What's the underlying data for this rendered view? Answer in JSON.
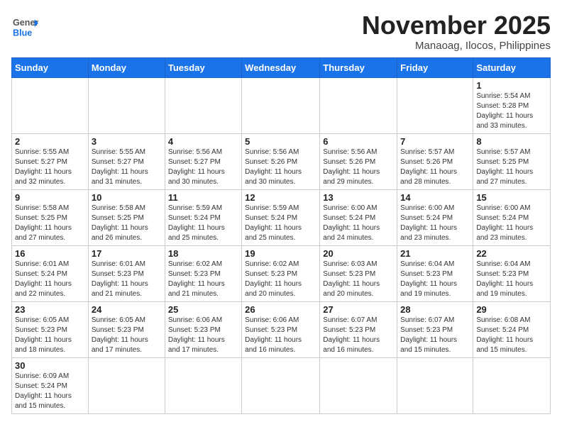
{
  "header": {
    "logo_general": "General",
    "logo_blue": "Blue",
    "month_title": "November 2025",
    "location": "Manaoag, Ilocos, Philippines"
  },
  "weekdays": [
    "Sunday",
    "Monday",
    "Tuesday",
    "Wednesday",
    "Thursday",
    "Friday",
    "Saturday"
  ],
  "weeks": [
    [
      {
        "day": "",
        "info": ""
      },
      {
        "day": "",
        "info": ""
      },
      {
        "day": "",
        "info": ""
      },
      {
        "day": "",
        "info": ""
      },
      {
        "day": "",
        "info": ""
      },
      {
        "day": "",
        "info": ""
      },
      {
        "day": "1",
        "info": "Sunrise: 5:54 AM\nSunset: 5:28 PM\nDaylight: 11 hours\nand 33 minutes."
      }
    ],
    [
      {
        "day": "2",
        "info": "Sunrise: 5:55 AM\nSunset: 5:27 PM\nDaylight: 11 hours\nand 32 minutes."
      },
      {
        "day": "3",
        "info": "Sunrise: 5:55 AM\nSunset: 5:27 PM\nDaylight: 11 hours\nand 31 minutes."
      },
      {
        "day": "4",
        "info": "Sunrise: 5:56 AM\nSunset: 5:27 PM\nDaylight: 11 hours\nand 30 minutes."
      },
      {
        "day": "5",
        "info": "Sunrise: 5:56 AM\nSunset: 5:26 PM\nDaylight: 11 hours\nand 30 minutes."
      },
      {
        "day": "6",
        "info": "Sunrise: 5:56 AM\nSunset: 5:26 PM\nDaylight: 11 hours\nand 29 minutes."
      },
      {
        "day": "7",
        "info": "Sunrise: 5:57 AM\nSunset: 5:26 PM\nDaylight: 11 hours\nand 28 minutes."
      },
      {
        "day": "8",
        "info": "Sunrise: 5:57 AM\nSunset: 5:25 PM\nDaylight: 11 hours\nand 27 minutes."
      }
    ],
    [
      {
        "day": "9",
        "info": "Sunrise: 5:58 AM\nSunset: 5:25 PM\nDaylight: 11 hours\nand 27 minutes."
      },
      {
        "day": "10",
        "info": "Sunrise: 5:58 AM\nSunset: 5:25 PM\nDaylight: 11 hours\nand 26 minutes."
      },
      {
        "day": "11",
        "info": "Sunrise: 5:59 AM\nSunset: 5:24 PM\nDaylight: 11 hours\nand 25 minutes."
      },
      {
        "day": "12",
        "info": "Sunrise: 5:59 AM\nSunset: 5:24 PM\nDaylight: 11 hours\nand 25 minutes."
      },
      {
        "day": "13",
        "info": "Sunrise: 6:00 AM\nSunset: 5:24 PM\nDaylight: 11 hours\nand 24 minutes."
      },
      {
        "day": "14",
        "info": "Sunrise: 6:00 AM\nSunset: 5:24 PM\nDaylight: 11 hours\nand 23 minutes."
      },
      {
        "day": "15",
        "info": "Sunrise: 6:00 AM\nSunset: 5:24 PM\nDaylight: 11 hours\nand 23 minutes."
      }
    ],
    [
      {
        "day": "16",
        "info": "Sunrise: 6:01 AM\nSunset: 5:24 PM\nDaylight: 11 hours\nand 22 minutes."
      },
      {
        "day": "17",
        "info": "Sunrise: 6:01 AM\nSunset: 5:23 PM\nDaylight: 11 hours\nand 21 minutes."
      },
      {
        "day": "18",
        "info": "Sunrise: 6:02 AM\nSunset: 5:23 PM\nDaylight: 11 hours\nand 21 minutes."
      },
      {
        "day": "19",
        "info": "Sunrise: 6:02 AM\nSunset: 5:23 PM\nDaylight: 11 hours\nand 20 minutes."
      },
      {
        "day": "20",
        "info": "Sunrise: 6:03 AM\nSunset: 5:23 PM\nDaylight: 11 hours\nand 20 minutes."
      },
      {
        "day": "21",
        "info": "Sunrise: 6:04 AM\nSunset: 5:23 PM\nDaylight: 11 hours\nand 19 minutes."
      },
      {
        "day": "22",
        "info": "Sunrise: 6:04 AM\nSunset: 5:23 PM\nDaylight: 11 hours\nand 19 minutes."
      }
    ],
    [
      {
        "day": "23",
        "info": "Sunrise: 6:05 AM\nSunset: 5:23 PM\nDaylight: 11 hours\nand 18 minutes."
      },
      {
        "day": "24",
        "info": "Sunrise: 6:05 AM\nSunset: 5:23 PM\nDaylight: 11 hours\nand 17 minutes."
      },
      {
        "day": "25",
        "info": "Sunrise: 6:06 AM\nSunset: 5:23 PM\nDaylight: 11 hours\nand 17 minutes."
      },
      {
        "day": "26",
        "info": "Sunrise: 6:06 AM\nSunset: 5:23 PM\nDaylight: 11 hours\nand 16 minutes."
      },
      {
        "day": "27",
        "info": "Sunrise: 6:07 AM\nSunset: 5:23 PM\nDaylight: 11 hours\nand 16 minutes."
      },
      {
        "day": "28",
        "info": "Sunrise: 6:07 AM\nSunset: 5:23 PM\nDaylight: 11 hours\nand 15 minutes."
      },
      {
        "day": "29",
        "info": "Sunrise: 6:08 AM\nSunset: 5:24 PM\nDaylight: 11 hours\nand 15 minutes."
      }
    ],
    [
      {
        "day": "30",
        "info": "Sunrise: 6:09 AM\nSunset: 5:24 PM\nDaylight: 11 hours\nand 15 minutes."
      },
      {
        "day": "",
        "info": ""
      },
      {
        "day": "",
        "info": ""
      },
      {
        "day": "",
        "info": ""
      },
      {
        "day": "",
        "info": ""
      },
      {
        "day": "",
        "info": ""
      },
      {
        "day": "",
        "info": ""
      }
    ]
  ]
}
